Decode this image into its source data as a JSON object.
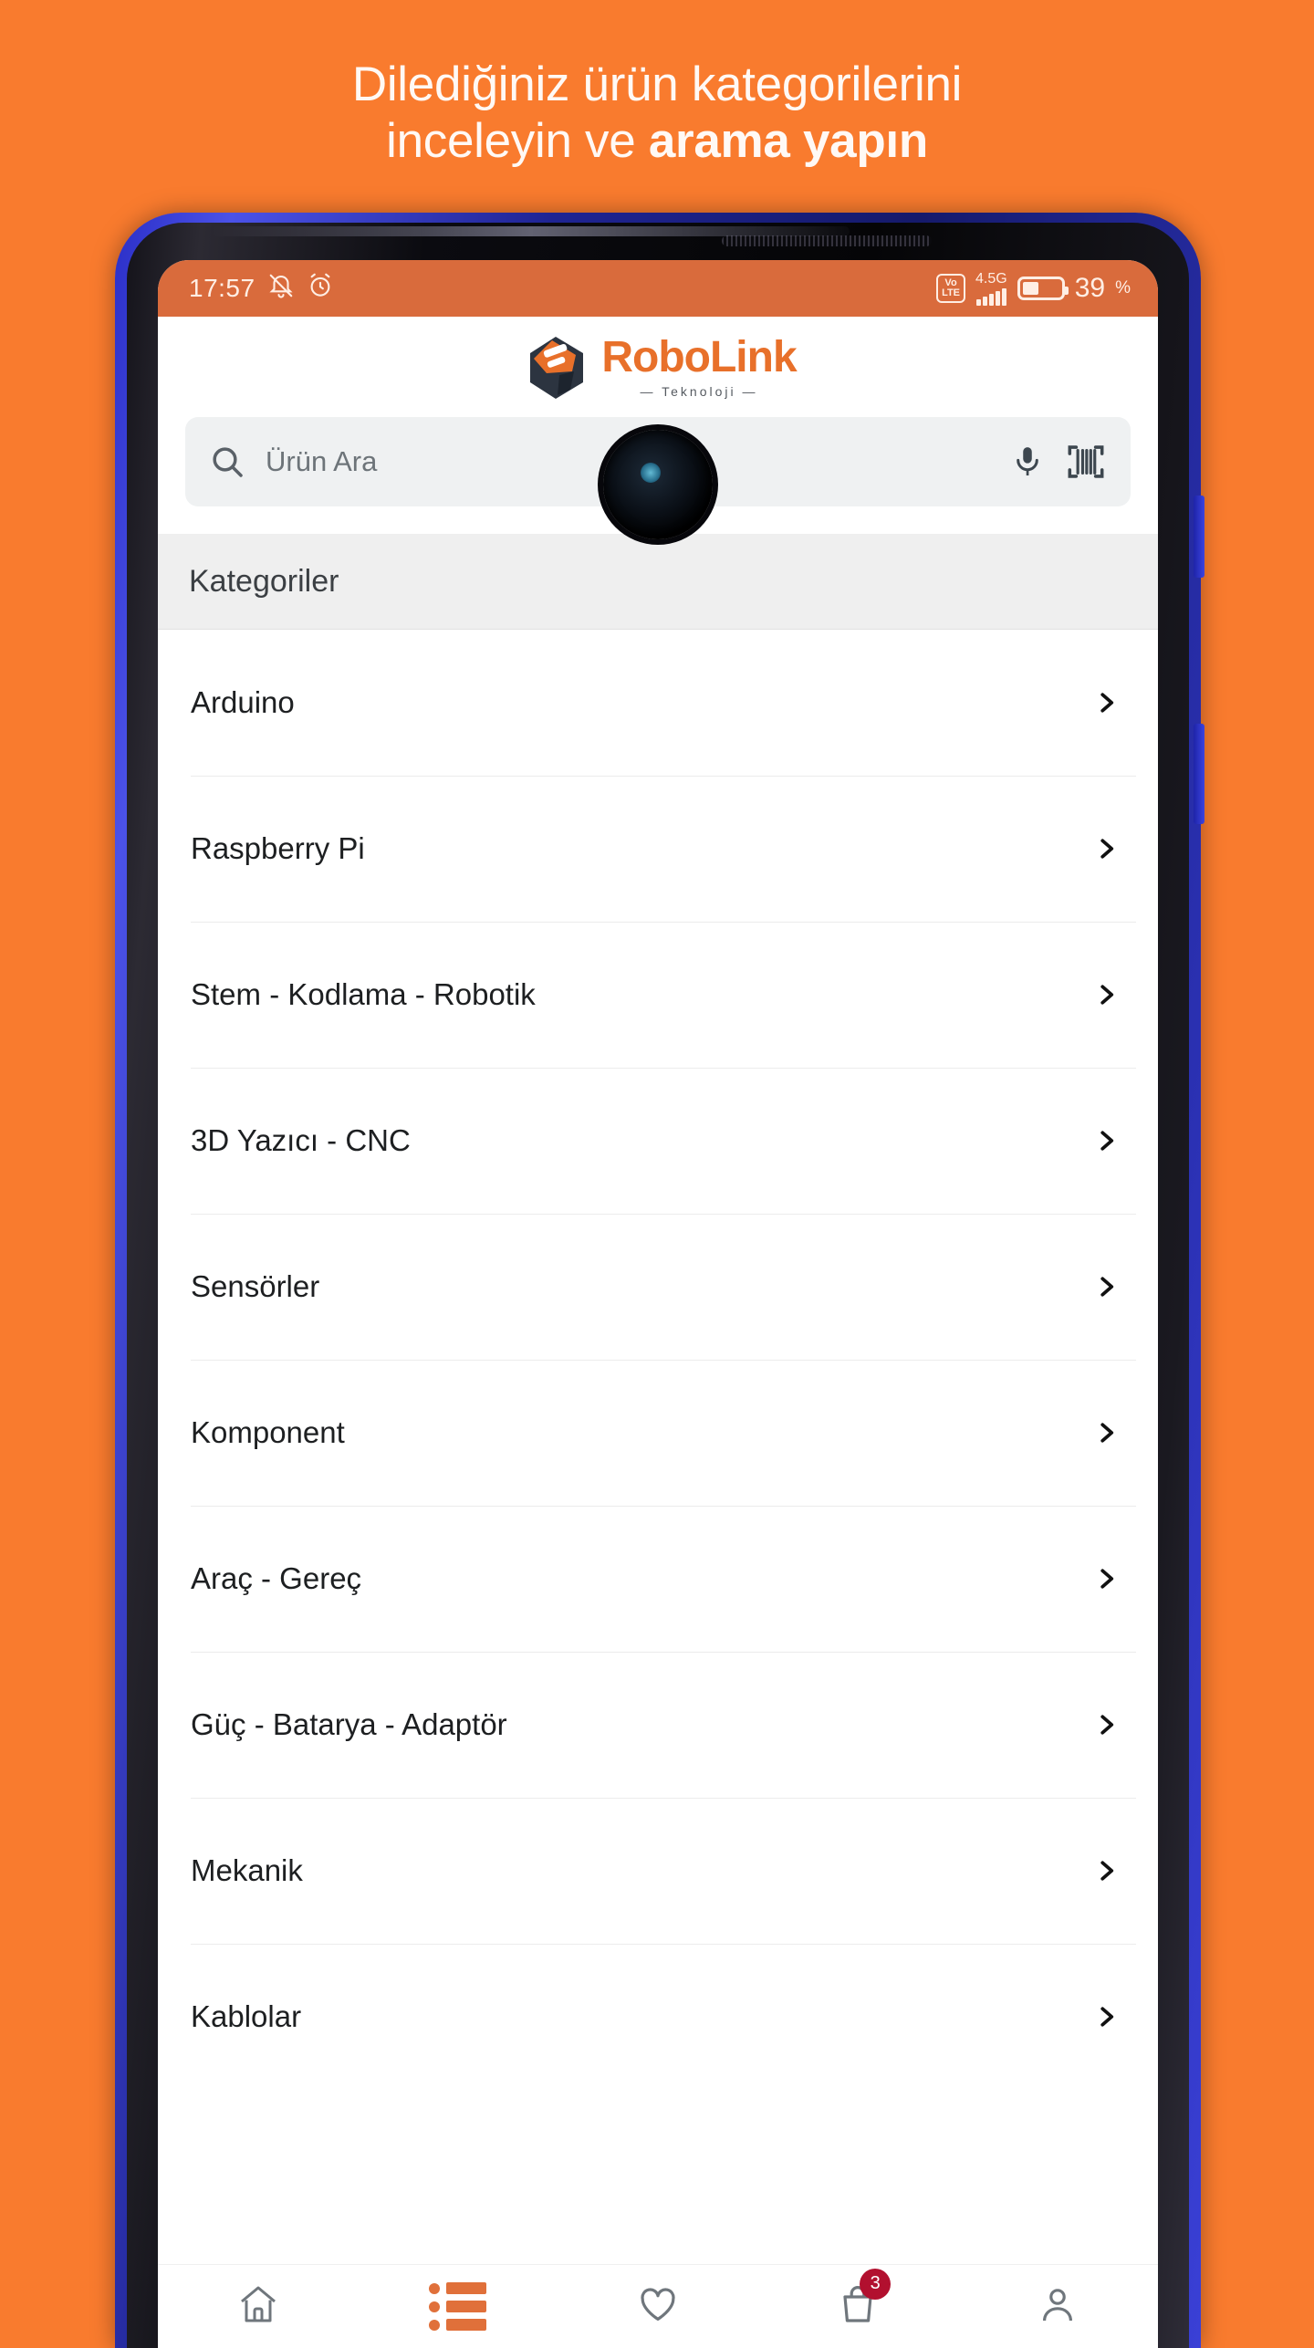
{
  "promo": {
    "headline_line1": "Dilediğiniz ürün kategorilerini",
    "headline_line2_normal": "inceleyin ve ",
    "headline_line2_bold": "arama yapın",
    "background_color": "#F97B2E"
  },
  "status_bar": {
    "time": "17:57",
    "mute_icon": "bell-muted-icon",
    "alarm_icon": "alarm-clock-icon",
    "volte_top": "Vo",
    "volte_bottom": "LTE",
    "network_generation": "4.5G",
    "signal_icon": "signal-bars-icon",
    "battery_icon": "battery-icon",
    "battery_percent": "39",
    "battery_percent_symbol": "%",
    "background_color": "#D96B3C"
  },
  "app_header": {
    "logo_icon": "robolink-robot-head-icon",
    "brand_name": "RoboLink",
    "brand_tagline": "— Teknoloji —",
    "brand_color": "#E8702A"
  },
  "search": {
    "placeholder": "Ürün Ara",
    "value": "",
    "search_icon": "search-icon",
    "mic_icon": "microphone-icon",
    "barcode_icon": "barcode-scanner-icon"
  },
  "categories_section": {
    "title": "Kategoriler",
    "chevron_icon": "chevron-right-icon",
    "items": [
      {
        "label": "Arduino"
      },
      {
        "label": "Raspberry Pi"
      },
      {
        "label": "Stem - Kodlama - Robotik"
      },
      {
        "label": "3D Yazıcı - CNC"
      },
      {
        "label": "Sensörler"
      },
      {
        "label": "Komponent"
      },
      {
        "label": "Araç - Gereç"
      },
      {
        "label": "Güç - Batarya - Adaptör"
      },
      {
        "label": "Mekanik"
      },
      {
        "label": "Kablolar"
      }
    ]
  },
  "bottom_nav": {
    "items": [
      {
        "name": "home",
        "icon": "home-icon",
        "active": false
      },
      {
        "name": "categories",
        "icon": "categories-list-icon",
        "active": true
      },
      {
        "name": "favorites",
        "icon": "heart-icon",
        "active": false
      },
      {
        "name": "cart",
        "icon": "shopping-bag-icon",
        "active": false,
        "badge": "3"
      },
      {
        "name": "account",
        "icon": "person-icon",
        "active": false
      }
    ],
    "active_color": "#E0703A",
    "badge_color": "#B2102F"
  }
}
